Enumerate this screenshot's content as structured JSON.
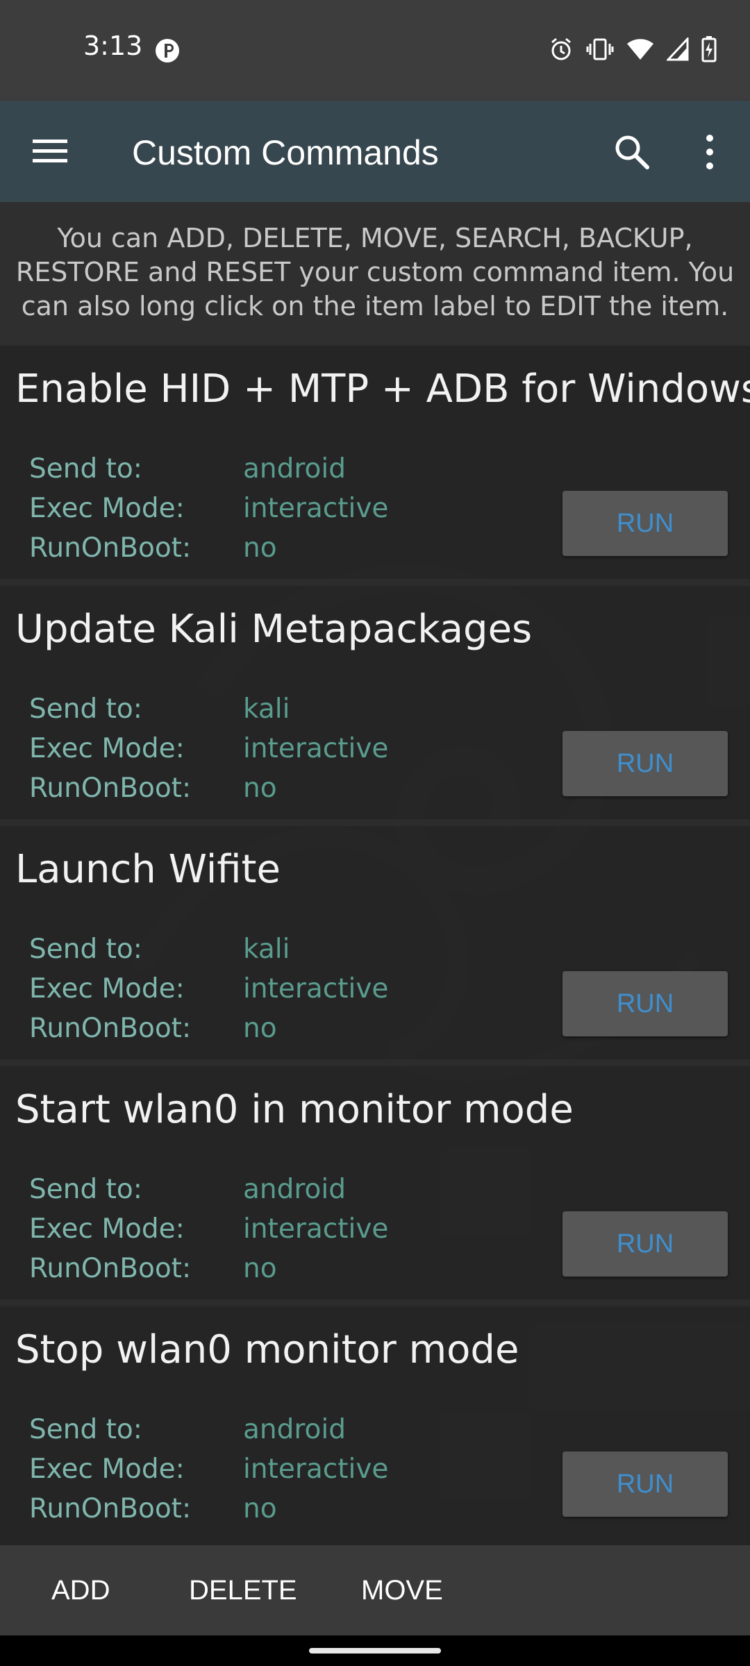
{
  "status_bar": {
    "time": "3:13",
    "icons": [
      "notification-badge-icon",
      "alarm-icon",
      "vibrate-icon",
      "wifi-icon",
      "signal-icon",
      "battery-charging-icon"
    ]
  },
  "app_bar": {
    "title": "Custom Commands",
    "icons": [
      "menu-icon",
      "search-icon",
      "more-vert-icon"
    ]
  },
  "description": "You can ADD, DELETE, MOVE, SEARCH, BACKUP, RESTORE and RESET your custom command item. You can also long click on the item label to EDIT the item.",
  "labels": {
    "send_to": "Send to:",
    "exec_mode": "Exec Mode:",
    "run_on_boot": "RunOnBoot:",
    "run": "RUN"
  },
  "commands": [
    {
      "title": "Enable HID + MTP + ADB for Windows",
      "send_to": "android",
      "exec_mode": "interactive",
      "run_on_boot": "no"
    },
    {
      "title": "Update Kali Metapackages",
      "send_to": "kali",
      "exec_mode": "interactive",
      "run_on_boot": "no"
    },
    {
      "title": "Launch Wifite",
      "send_to": "kali",
      "exec_mode": "interactive",
      "run_on_boot": "no"
    },
    {
      "title": "Start wlan0 in monitor mode",
      "send_to": "android",
      "exec_mode": "interactive",
      "run_on_boot": "no"
    },
    {
      "title": "Stop wlan0 monitor mode",
      "send_to": "android",
      "exec_mode": "interactive",
      "run_on_boot": "no"
    }
  ],
  "bottom_bar": {
    "add": "ADD",
    "delete": "DELETE",
    "move": "MOVE"
  },
  "colors": {
    "app_bar": "#37474f",
    "value_text": "#5a9c8e",
    "run_text": "#3f8fcf"
  }
}
